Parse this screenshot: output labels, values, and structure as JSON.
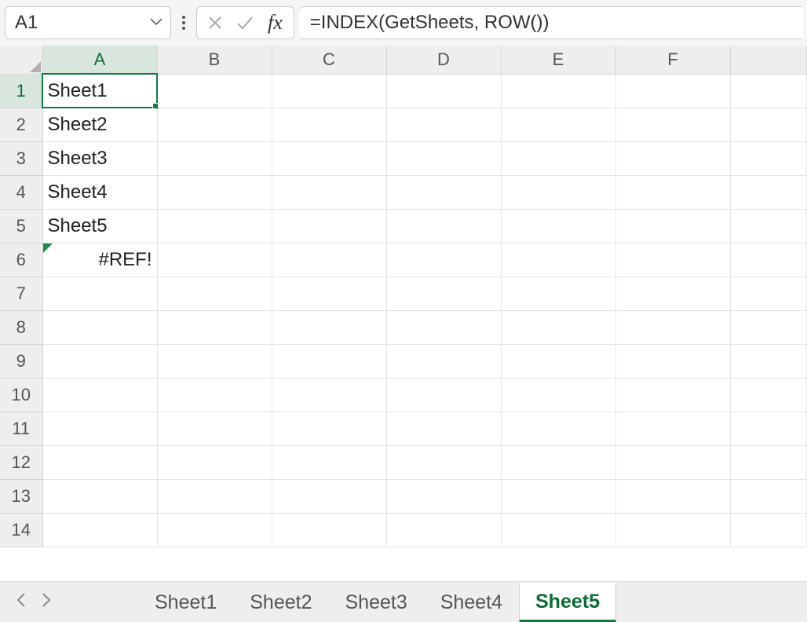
{
  "name_box": {
    "value": "A1"
  },
  "formula_bar": {
    "fx_label": "fx",
    "formula": "=INDEX(GetSheets, ROW())"
  },
  "grid": {
    "columns": [
      "A",
      "B",
      "C",
      "D",
      "E",
      "F"
    ],
    "active_col_index": 0,
    "row_count": 14,
    "active_row_index": 0,
    "cells": {
      "A1": "Sheet1",
      "A2": "Sheet2",
      "A3": "Sheet3",
      "A4": "Sheet4",
      "A5": "Sheet5",
      "A6": "#REF!"
    },
    "error_cells": [
      "A6"
    ],
    "selected_cell": "A1"
  },
  "sheet_tabs": {
    "tabs": [
      "Sheet1",
      "Sheet2",
      "Sheet3",
      "Sheet4",
      "Sheet5"
    ],
    "active_index": 4
  }
}
